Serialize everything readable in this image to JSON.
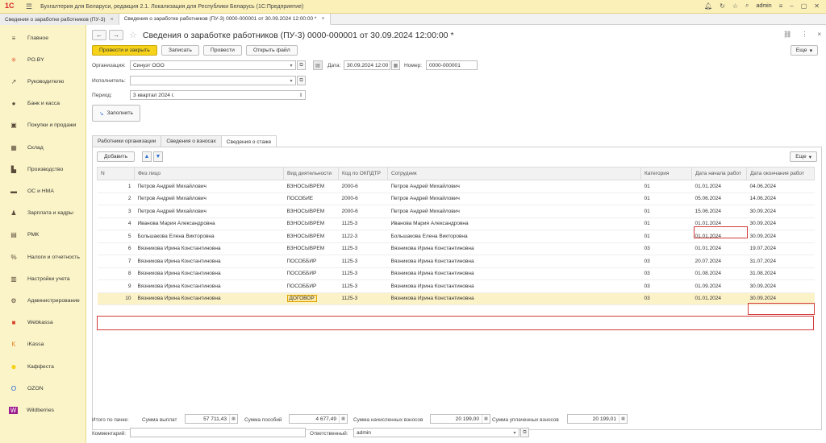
{
  "app": {
    "logo": "1С",
    "title": "Бухгалтерия для Беларуси, редакция 2.1. Локализация для Республики Беларусь  (1С:Предприятие)",
    "user": "admin"
  },
  "window_tabs": [
    {
      "label": "Сведения о заработке работников (ПУ-3)",
      "close": "×"
    },
    {
      "label": "Сведения о заработке работников (ПУ-3) 0000-000001 от 30.09.2024 12:00:00 *",
      "close": "×"
    }
  ],
  "sidebar": {
    "items": [
      {
        "label": "Главное",
        "icon": "menu-icon",
        "glyph": "≡"
      },
      {
        "label": "PO.BY",
        "icon": "asterisk-icon",
        "glyph": "✳"
      },
      {
        "label": "Руководителю",
        "icon": "chart-line-icon",
        "glyph": "↗"
      },
      {
        "label": "Банк и касса",
        "icon": "bank-icon",
        "glyph": "●"
      },
      {
        "label": "Покупки и продажи",
        "icon": "cart-icon",
        "glyph": "▣"
      },
      {
        "label": "Склад",
        "icon": "warehouse-icon",
        "glyph": "▦"
      },
      {
        "label": "Производство",
        "icon": "factory-icon",
        "glyph": "▙"
      },
      {
        "label": "ОС и НМА",
        "icon": "car-icon",
        "glyph": "▬"
      },
      {
        "label": "Зарплата и кадры",
        "icon": "person-icon",
        "glyph": "♟"
      },
      {
        "label": "РМК",
        "icon": "register-icon",
        "glyph": "▤"
      },
      {
        "label": "Налоги и отчетность",
        "icon": "percent-icon",
        "glyph": "%"
      },
      {
        "label": "Настройки учета",
        "icon": "book-icon",
        "glyph": "▥"
      },
      {
        "label": "Администрирование",
        "icon": "gear-icon",
        "glyph": "⚙"
      },
      {
        "label": "Webkassa",
        "icon": "webkassa-icon",
        "glyph": "■"
      },
      {
        "label": "iKassa",
        "icon": "ikassa-icon",
        "glyph": "K"
      },
      {
        "label": "Каффеста",
        "icon": "kaffesta-icon",
        "glyph": "●"
      },
      {
        "label": "OZON",
        "icon": "ozon-icon",
        "glyph": "O"
      },
      {
        "label": "Wildberries",
        "icon": "wildberries-icon",
        "glyph": "W"
      }
    ]
  },
  "header": {
    "back": "←",
    "forward": "→",
    "star": "☆",
    "title": "Сведения о заработке работников (ПУ-3) 0000-000001 от 30.09.2024 12:00:00 *",
    "link": "⛓",
    "menu": "⋮",
    "close": "×"
  },
  "toolbar": {
    "post_close": "Провести и закрыть",
    "save": "Записать",
    "post": "Провести",
    "open_file": "Открыть файл",
    "more": "Еще"
  },
  "form": {
    "org_label": "Организация:",
    "org_value": "Синуэт ООО",
    "date_label": "Дата:",
    "date_value": "30.09.2024 12:00",
    "number_label": "Номер:",
    "number_value": "0000-000001",
    "executor_label": "Исполнитель:",
    "executor_value": "",
    "period_label": "Период:",
    "period_value": "3 квартал 2024 г.",
    "fill_button": "Заполнить"
  },
  "form_tabs": [
    "Работники организации",
    "Сведения о взносах",
    "Сведения о стаже"
  ],
  "grid": {
    "add_button": "Добавить",
    "more": "Еще",
    "columns": [
      "N",
      "Физ лицо",
      "Вид деятельности",
      "Код по ОКПДТР",
      "Сотрудник",
      "Категория",
      "Дата начала работ",
      "Дата окончания работ"
    ],
    "rows": [
      [
        "1",
        "Петров Андрей Михайлович",
        "ВЗНОСЫВРЕМ",
        "2000-6",
        "Петров Андрей Михайлович",
        "01",
        "01.01.2024",
        "04.06.2024"
      ],
      [
        "2",
        "Петров Андрей Михайлович",
        "ПОСОБИЕ",
        "2000-6",
        "Петров Андрей Михайлович",
        "01",
        "05.06.2024",
        "14.06.2024"
      ],
      [
        "3",
        "Петров Андрей Михайлович",
        "ВЗНОСЫВРЕМ",
        "2000-6",
        "Петров Андрей Михайлович",
        "01",
        "15.06.2024",
        "30.09.2024"
      ],
      [
        "4",
        "Иванова Мария Александровна",
        "ВЗНОСЫВРЕМ",
        "1125-3",
        "Иванова Мария Александровна",
        "01",
        "01.01.2024",
        "30.09.2024"
      ],
      [
        "5",
        "Большакова Елена Викторовна",
        "ВЗНОСЫВРЕМ",
        "1122-3",
        "Большакова Елена Викторовна",
        "01",
        "01.01.2024",
        "30.09.2024"
      ],
      [
        "6",
        "Вязникова Ирина Константиновна",
        "ВЗНОСЫВРЕМ",
        "1125-3",
        "Вязникова Ирина Константиновна",
        "03",
        "01.01.2024",
        "19.07.2024"
      ],
      [
        "7",
        "Вязникова Ирина Константиновна",
        "ПОСОББИР",
        "1125-3",
        "Вязникова Ирина Константиновна",
        "03",
        "20.07.2024",
        "31.07.2024"
      ],
      [
        "8",
        "Вязникова Ирина Константиновна",
        "ПОСОББИР",
        "1125-3",
        "Вязникова Ирина Константиновна",
        "03",
        "01.08.2024",
        "31.08.2024"
      ],
      [
        "9",
        "Вязникова Ирина Константиновна",
        "ПОСОББИР",
        "1125-3",
        "Вязникова Ирина Константиновна",
        "03",
        "01.09.2024",
        "30.09.2024"
      ],
      [
        "10",
        "Вязникова Ирина Константиновна",
        "ДОГОВОР",
        "1125-3",
        "Вязникова Ирина Константиновна",
        "03",
        "01.01.2024",
        "30.09.2024"
      ]
    ]
  },
  "footer": {
    "total_label": "Итого по пачке:",
    "payments_label": "Сумма выплат",
    "payments_value": "57 711,43",
    "benefits_label": "Сумма пособий",
    "benefits_value": "4 677,49",
    "accrued_label": "Сумма начисленных взносов",
    "accrued_value": "20 199,00",
    "paid_label": "Сумма уплаченных взносов",
    "paid_value": "20 199,01",
    "comment_label": "Комментарий:",
    "comment_value": "",
    "responsible_label": "Ответственный:",
    "responsible_value": "admin"
  }
}
